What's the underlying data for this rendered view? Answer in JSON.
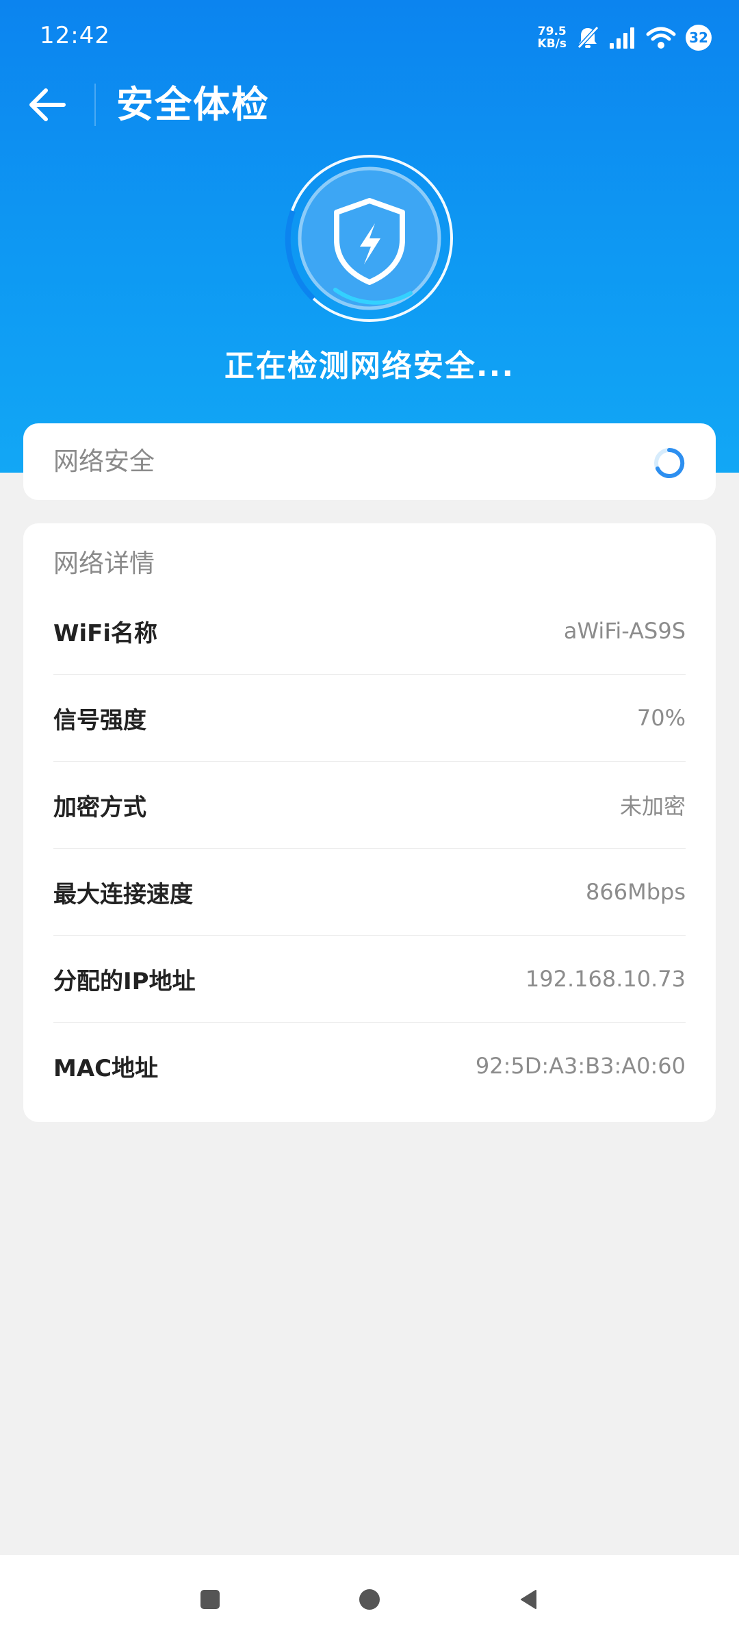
{
  "status_bar": {
    "time": "12:42",
    "net_speed_value": "79.5",
    "net_speed_unit": "KB/s",
    "battery": "32",
    "icons": [
      "mute-bell-icon",
      "signal-icon",
      "wifi-icon"
    ]
  },
  "header": {
    "title": "安全体检",
    "back_icon": "arrow-left-icon"
  },
  "scanner": {
    "icon": "shield-bolt-icon",
    "status_text": "正在检测网络安全..."
  },
  "security_card": {
    "label": "网络安全",
    "state_icon": "loading-spinner-icon"
  },
  "details": {
    "title": "网络详情",
    "rows": [
      {
        "label": "WiFi名称",
        "value": "aWiFi-AS9S"
      },
      {
        "label": "信号强度",
        "value": "70%"
      },
      {
        "label": "加密方式",
        "value": "未加密"
      },
      {
        "label": "最大连接速度",
        "value": "866Mbps"
      },
      {
        "label": "分配的IP地址",
        "value": "192.168.10.73"
      },
      {
        "label": "MAC地址",
        "value": "92:5D:A3:B3:A0:60"
      }
    ]
  },
  "nav_bar": {
    "buttons": [
      "recents-square-icon",
      "home-circle-icon",
      "back-triangle-icon"
    ]
  },
  "colors": {
    "hero_top": "#0c84ef",
    "hero_bottom": "#12a7f5",
    "background": "#f1f1f1",
    "card": "#ffffff"
  }
}
